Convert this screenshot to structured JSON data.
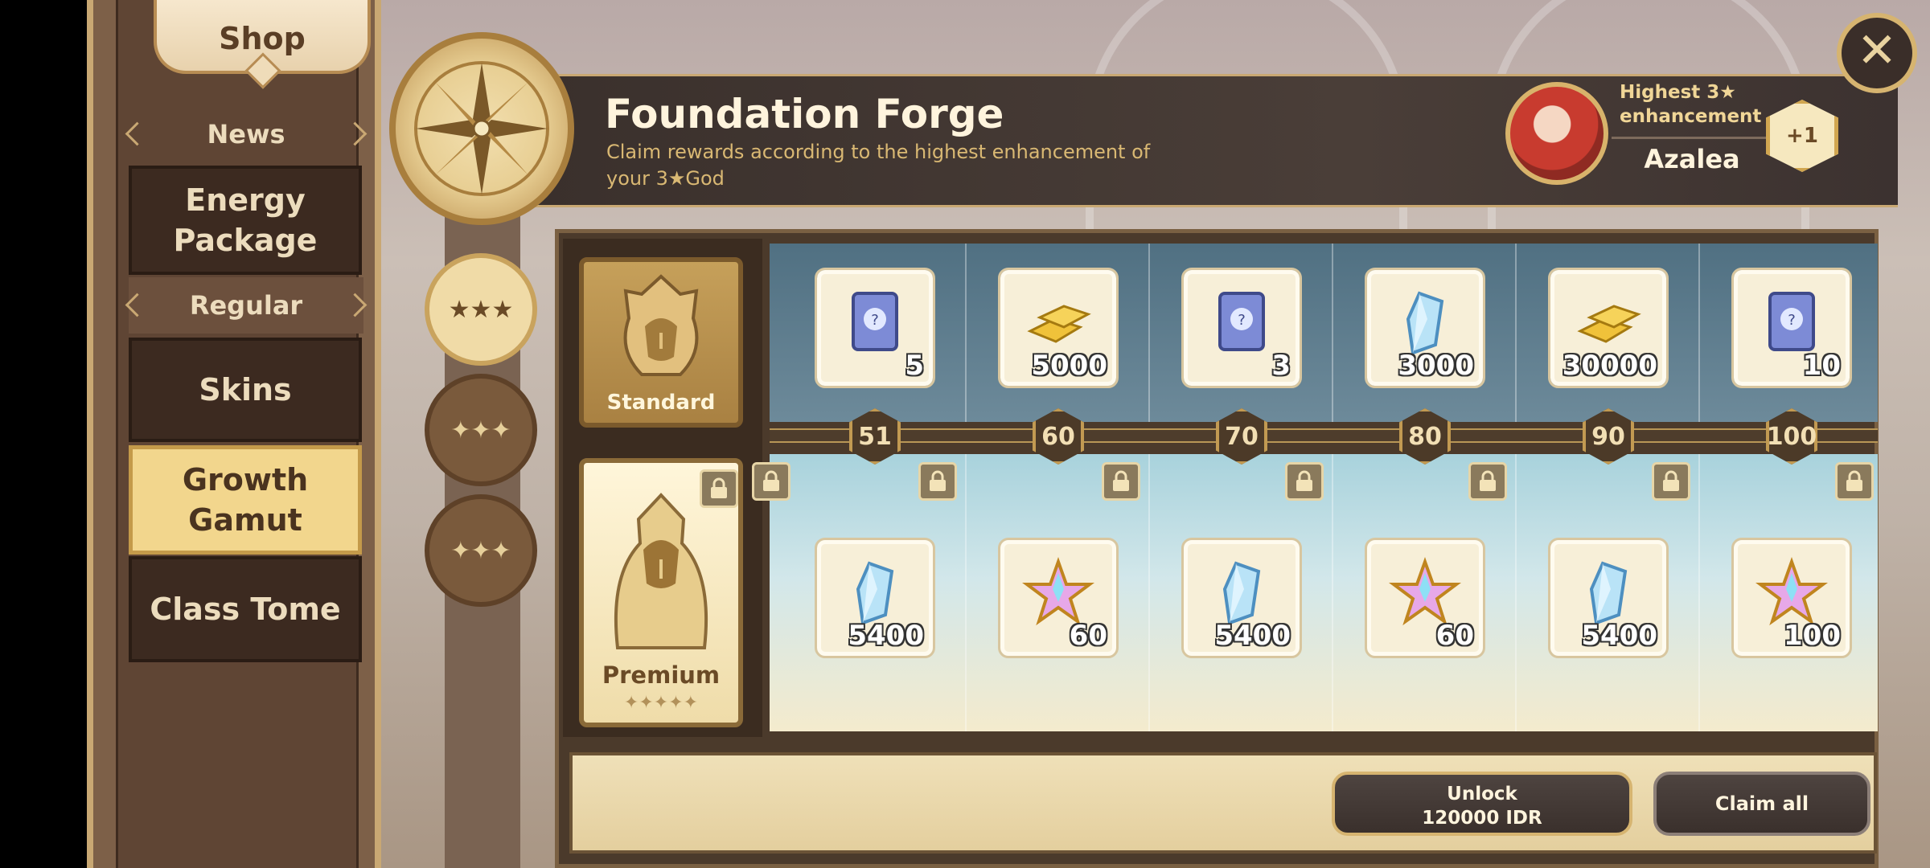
{
  "sidebar": {
    "shop_title": "Shop",
    "categories": [
      {
        "label": "News"
      },
      {
        "label": "Regular"
      }
    ],
    "items": [
      {
        "label": "Energy Package"
      },
      {
        "label": "Skins"
      },
      {
        "label": "Growth Gamut",
        "active": true
      },
      {
        "label": "Class Tome"
      }
    ]
  },
  "header": {
    "title": "Foundation Forge",
    "subtitle": "Claim rewards according to the highest enhancement of your 3★God",
    "highest_label": "Highest 3★ enhancement",
    "hero_name": "Azalea",
    "enhancement": "+1"
  },
  "star_tabs": [
    {
      "stars": "★★★",
      "selected": true
    },
    {
      "stars": "✦✦✦",
      "selected": false
    },
    {
      "stars": "✦✦✦",
      "selected": false
    }
  ],
  "tracks": {
    "standard_label": "Standard",
    "premium_label": "Premium",
    "premium_stars": "✦✦✦✦✦"
  },
  "levels": [
    "51",
    "60",
    "70",
    "80",
    "90",
    "100"
  ],
  "standard_rewards": [
    {
      "icon": "tome-icon",
      "qty": "5"
    },
    {
      "icon": "gold-bars-icon",
      "qty": "5000"
    },
    {
      "icon": "tome-icon",
      "qty": "3"
    },
    {
      "icon": "crystal-icon",
      "qty": "3000"
    },
    {
      "icon": "gold-bars-icon",
      "qty": "30000"
    },
    {
      "icon": "tome-icon",
      "qty": "10"
    }
  ],
  "premium_rewards": [
    {
      "icon": "crystal-icon",
      "qty": "5400"
    },
    {
      "icon": "star-shard-icon",
      "qty": "60"
    },
    {
      "icon": "crystal-icon",
      "qty": "5400"
    },
    {
      "icon": "star-shard-icon",
      "qty": "60"
    },
    {
      "icon": "crystal-icon",
      "qty": "5400"
    },
    {
      "icon": "star-shard-icon",
      "qty": "100"
    }
  ],
  "footer": {
    "unlock_label": "Unlock",
    "unlock_price": "120000 IDR",
    "claim_all_label": "Claim all"
  },
  "close_icon": "✕",
  "colors": {
    "accent_gold": "#c9a873",
    "panel_dark": "#3a302c",
    "active_tab": "#f2d68d"
  }
}
